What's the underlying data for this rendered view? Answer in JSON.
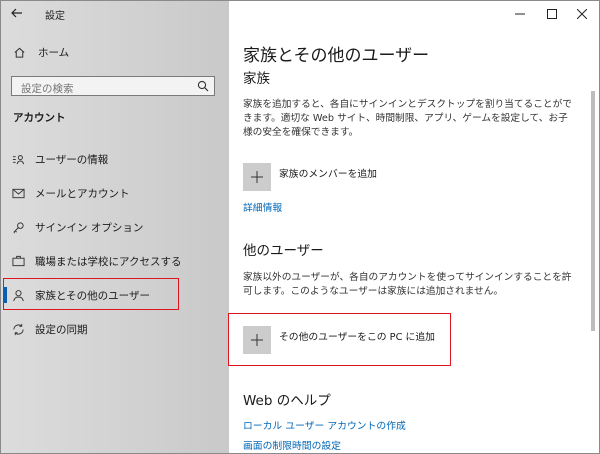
{
  "window": {
    "title": "設定",
    "minimize_icon": "minimize-icon",
    "maximize_icon": "maximize-icon",
    "close_icon": "close-icon"
  },
  "sidebar": {
    "home_label": "ホーム",
    "search_placeholder": "設定の検索",
    "section_title": "アカウント",
    "items": [
      {
        "label": "ユーザーの情報",
        "icon": "user-info-icon"
      },
      {
        "label": "メールとアカウント",
        "icon": "mail-icon"
      },
      {
        "label": "サインイン オプション",
        "icon": "key-icon"
      },
      {
        "label": "職場または学校にアクセスする",
        "icon": "briefcase-icon"
      },
      {
        "label": "家族とその他のユーザー",
        "icon": "person-icon",
        "selected": true
      },
      {
        "label": "設定の同期",
        "icon": "sync-icon"
      }
    ],
    "accent_color": "#0a5fb4"
  },
  "main": {
    "page_title": "家族とその他のユーザー",
    "family": {
      "heading": "家族",
      "description": "家族を追加すると、各自にサインインとデスクトップを割り当てることができます。適切な Web サイト、時間制限、アプリ、ゲームを設定して、お子様の安全を確保できます。",
      "add_label": "家族のメンバーを追加",
      "details_link": "詳細情報"
    },
    "other_users": {
      "heading": "他のユーザー",
      "description": "家族以外のユーザーが、各自のアカウントを使ってサインインすることを許可します。このようなユーザーは家族には追加されません。",
      "add_label": "その他のユーザーをこの PC に追加"
    },
    "web_help": {
      "heading": "Web のヘルプ",
      "links": [
        "ローカル ユーザー アカウントの作成",
        "画面の制限時間の設定"
      ]
    },
    "link_color": "#0067b8",
    "highlight_color": "#e0141c"
  }
}
